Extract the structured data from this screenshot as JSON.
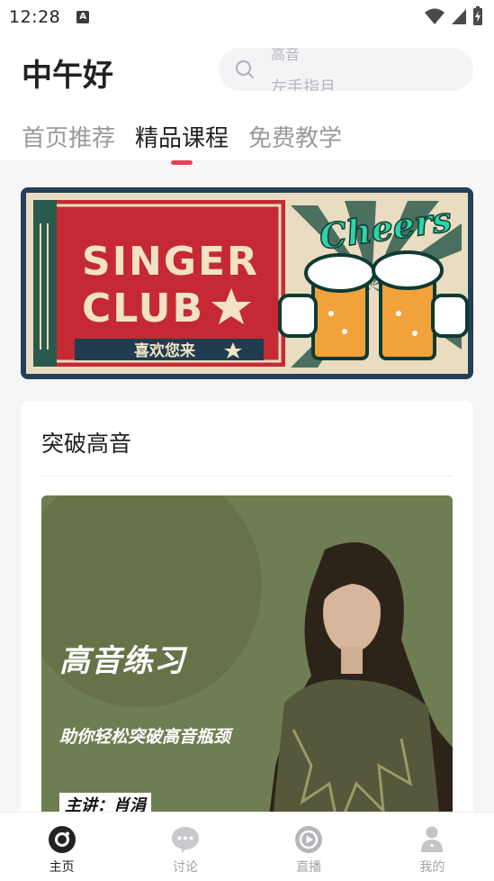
{
  "status_bar": {
    "time": "12:28",
    "sim_glyph": "A"
  },
  "header": {
    "greeting": "中午好",
    "search": {
      "hint_top": "高音",
      "hint": "左手指月"
    }
  },
  "tabs": [
    {
      "label": "首页推荐",
      "active": false
    },
    {
      "label": "精品课程",
      "active": true
    },
    {
      "label": "免费教学",
      "active": false
    }
  ],
  "banner": {
    "line1": "SINGER",
    "line2": "CLUB",
    "caption": "喜欢您来",
    "script_text": "Cheers"
  },
  "course_section": {
    "title": "突破高音",
    "course": {
      "title": "高音练习",
      "subtitle": "助你轻松突破高音瓶颈",
      "lecturer": "主讲：肖涓"
    }
  },
  "bottom_nav": [
    {
      "label": "主页",
      "icon": "home-record-icon",
      "active": true
    },
    {
      "label": "讨论",
      "icon": "chat-bubble-icon",
      "active": false
    },
    {
      "label": "直播",
      "icon": "play-circle-icon",
      "active": false
    },
    {
      "label": "我的",
      "icon": "profile-icon",
      "active": false
    }
  ],
  "colors": {
    "accent": "#ef3b55",
    "course_bg": "#6f7d53",
    "banner_red": "#c52a34",
    "banner_navy": "#23405a"
  }
}
